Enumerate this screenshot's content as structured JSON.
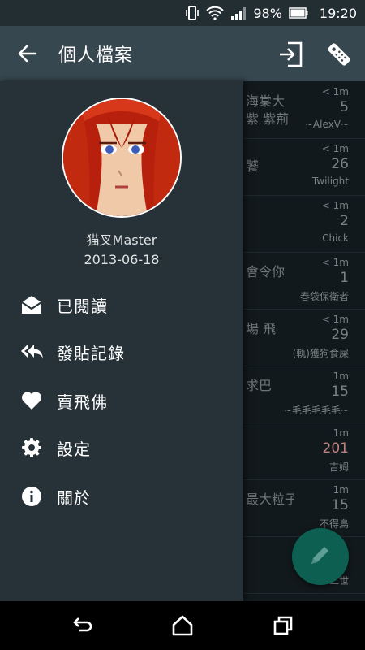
{
  "status_bar": {
    "battery": "98%",
    "time": "19:20"
  },
  "app_bar": {
    "title": "個人檔案"
  },
  "profile": {
    "username": "猫叉Master",
    "date": "2013-06-18"
  },
  "drawer_menu": [
    {
      "label": "已閱讀",
      "icon": "envelope-open-icon"
    },
    {
      "label": "發貼記錄",
      "icon": "reply-all-icon"
    },
    {
      "label": "賣飛佛",
      "icon": "heart-icon"
    },
    {
      "label": "設定",
      "icon": "gear-icon"
    },
    {
      "label": "關於",
      "icon": "info-icon"
    }
  ],
  "background_list": [
    {
      "title": "海棠大紫 紫荊",
      "time": "< 1m",
      "count": "5",
      "author": "~AlexV~"
    },
    {
      "title": "饕",
      "time": "< 1m",
      "count": "26",
      "author": "Twilight"
    },
    {
      "title": "",
      "time": "< 1m",
      "count": "2",
      "author": "Chick"
    },
    {
      "title": "會令你",
      "time": "< 1m",
      "count": "1",
      "author": "春袋保衛者"
    },
    {
      "title": "場 飛",
      "time": "< 1m",
      "count": "29",
      "author": "(軌)獲狗食屎"
    },
    {
      "title": "求巴",
      "time": "1m",
      "count": "15",
      "author": "~毛毛毛毛毛~"
    },
    {
      "title": "",
      "time": "1m",
      "count": "201",
      "author": "吉姆"
    },
    {
      "title": "最大粒子",
      "time": "1m",
      "count": "15",
      "author": "不得鳥"
    },
    {
      "title": "",
      "time": "",
      "count": "",
      "author": "二世"
    }
  ],
  "colors": {
    "appbar": "#37474f",
    "drawer": "#263238",
    "fab": "#0d5f52",
    "hot_count": "#c08080"
  }
}
